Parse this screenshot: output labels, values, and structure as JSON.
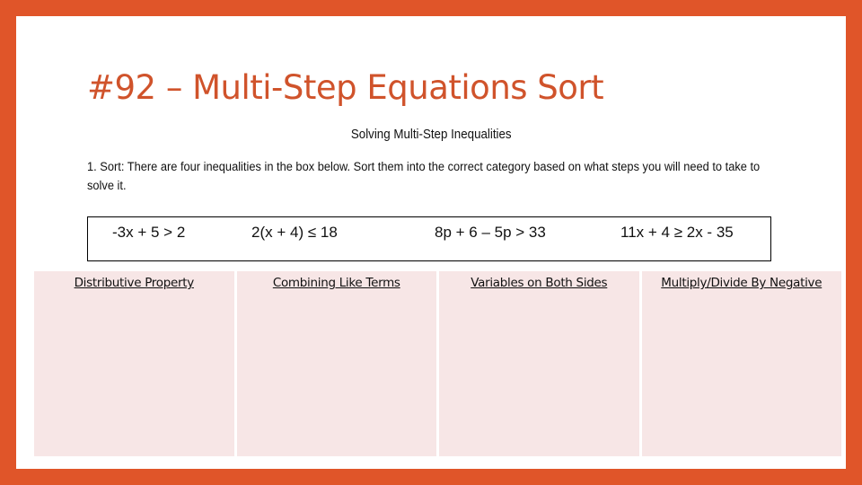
{
  "slide": {
    "title": "#92 – Multi-Step Equations Sort",
    "colors": {
      "frame": "#e05529",
      "title": "#d0532b",
      "column_fill": "#f7e6e6"
    }
  },
  "worksheet": {
    "heading": "Solving Multi-Step Inequalities",
    "instructions": "1. Sort:  There are four inequalities in the box below.  Sort them into the correct category based on what steps you will need to take to solve it.",
    "inequalities": [
      "-3x + 5 > 2",
      "2(x + 4) ≤ 18",
      "8p + 6 – 5p > 33",
      "11x + 4 ≥ 2x - 35"
    ]
  },
  "sort_table": {
    "columns": [
      {
        "header": "Distributive Property"
      },
      {
        "header": "Combining Like Terms"
      },
      {
        "header": "Variables on Both Sides"
      },
      {
        "header": "Multiply/Divide By Negative"
      }
    ]
  }
}
